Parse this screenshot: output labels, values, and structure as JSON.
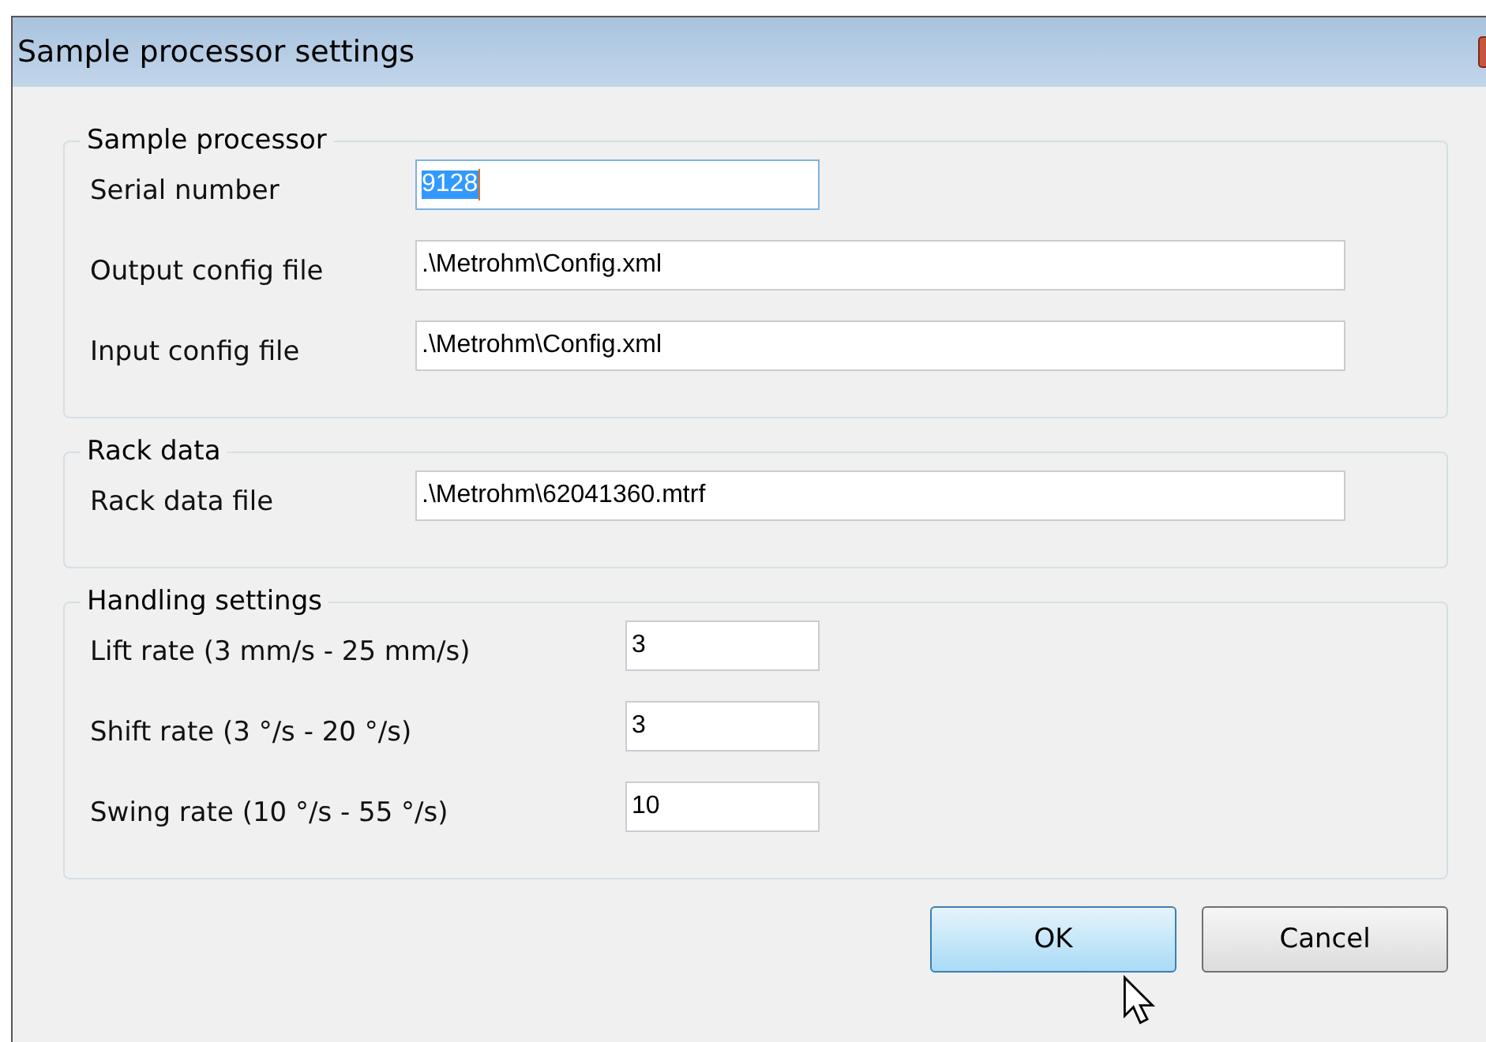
{
  "window": {
    "title": "Sample processor settings"
  },
  "groups": [
    {
      "title": "Sample processor",
      "narrow": false,
      "fields": [
        {
          "label": "Serial number",
          "value": "9128",
          "focused": true,
          "short": true
        },
        {
          "label": "Output config file",
          "value": ".\\Metrohm\\Config.xml",
          "focused": false,
          "short": false
        },
        {
          "label": "Input config file",
          "value": ".\\Metrohm\\Config.xml",
          "focused": false,
          "short": false
        }
      ]
    },
    {
      "title": "Rack data",
      "narrow": false,
      "fields": [
        {
          "label": "Rack data file",
          "value": ".\\Metrohm\\62041360.mtrf",
          "focused": false,
          "short": false
        }
      ]
    },
    {
      "title": "Handling settings",
      "narrow": true,
      "fields": [
        {
          "label": "Lift rate (3 mm/s - 25 mm/s)",
          "value": "3",
          "focused": false,
          "short": true
        },
        {
          "label": "Shift rate (3 °/s - 20 °/s)",
          "value": "3",
          "focused": false,
          "short": true
        },
        {
          "label": "Swing rate (10 °/s - 55 °/s)",
          "value": "10",
          "focused": false,
          "short": true
        }
      ]
    }
  ],
  "buttons": [
    {
      "label": "OK",
      "hovered": true
    },
    {
      "label": "Cancel",
      "hovered": false
    }
  ]
}
